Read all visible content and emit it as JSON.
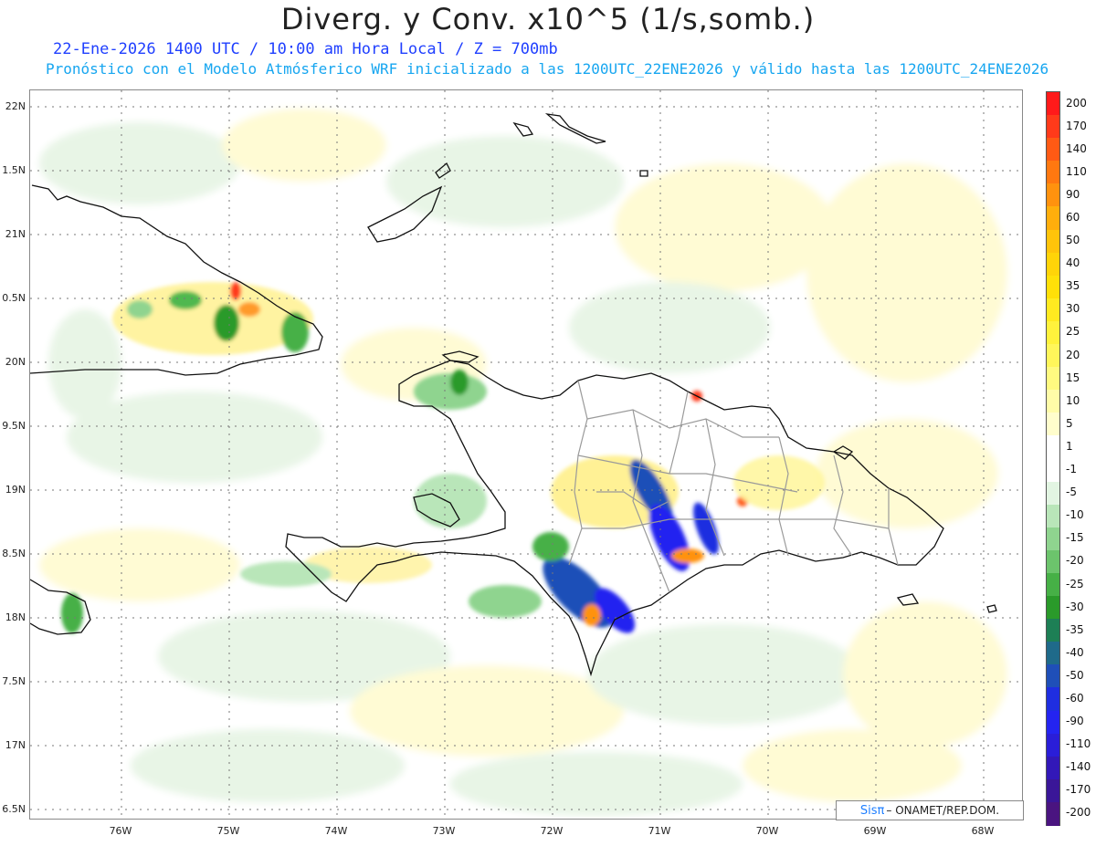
{
  "title": "Diverg. y Conv. x10^5 (1/s,somb.)",
  "subtitle_line1": "22-Ene-2026 1400 UTC / 10:00 am Hora Local / Z = 700mb",
  "subtitle_line2": "Pronóstico con el Modelo Atmósferico WRF inicializado a las 1200UTC_22ENE2026 y válido hasta las  1200UTC_24ENE2026",
  "lat_labels": [
    "22N",
    "1.5N",
    "21N",
    "0.5N",
    "20N",
    "9.5N",
    "19N",
    "8.5N",
    "18N",
    "7.5N",
    "17N",
    "6.5N"
  ],
  "lon_labels": [
    "76W",
    "75W",
    "74W",
    "73W",
    "72W",
    "71W",
    "70W",
    "69W",
    "68W"
  ],
  "legend": {
    "labels": [
      "200",
      "170",
      "140",
      "110",
      "90",
      "60",
      "50",
      "40",
      "35",
      "30",
      "25",
      "20",
      "15",
      "10",
      "5",
      "1",
      "-1",
      "-5",
      "-10",
      "-15",
      "-20",
      "-25",
      "-30",
      "-35",
      "-40",
      "-50",
      "-60",
      "-90",
      "-110",
      "-140",
      "-170",
      "-200"
    ],
    "colors": [
      "#ff1a1a",
      "#ff3a1a",
      "#ff5a14",
      "#ff7810",
      "#ff920e",
      "#ffae0c",
      "#ffc40a",
      "#ffd408",
      "#ffe008",
      "#ffea20",
      "#fff23c",
      "#fff65a",
      "#fffa80",
      "#fffca8",
      "#fffdcc",
      "#ffffff",
      "#ffffff",
      "#e2f5e2",
      "#b9e6b9",
      "#8fd48f",
      "#6cc46c",
      "#46b046",
      "#2a9a2a",
      "#1d7f55",
      "#1f6a8a",
      "#1f4fb8",
      "#1f2ee0",
      "#2424f0",
      "#2a1ed8",
      "#3218b8",
      "#3a1698",
      "#4a1480"
    ]
  },
  "credit": {
    "logo": "Sisπ",
    "text": " – ONAMET/REP.DOM."
  }
}
